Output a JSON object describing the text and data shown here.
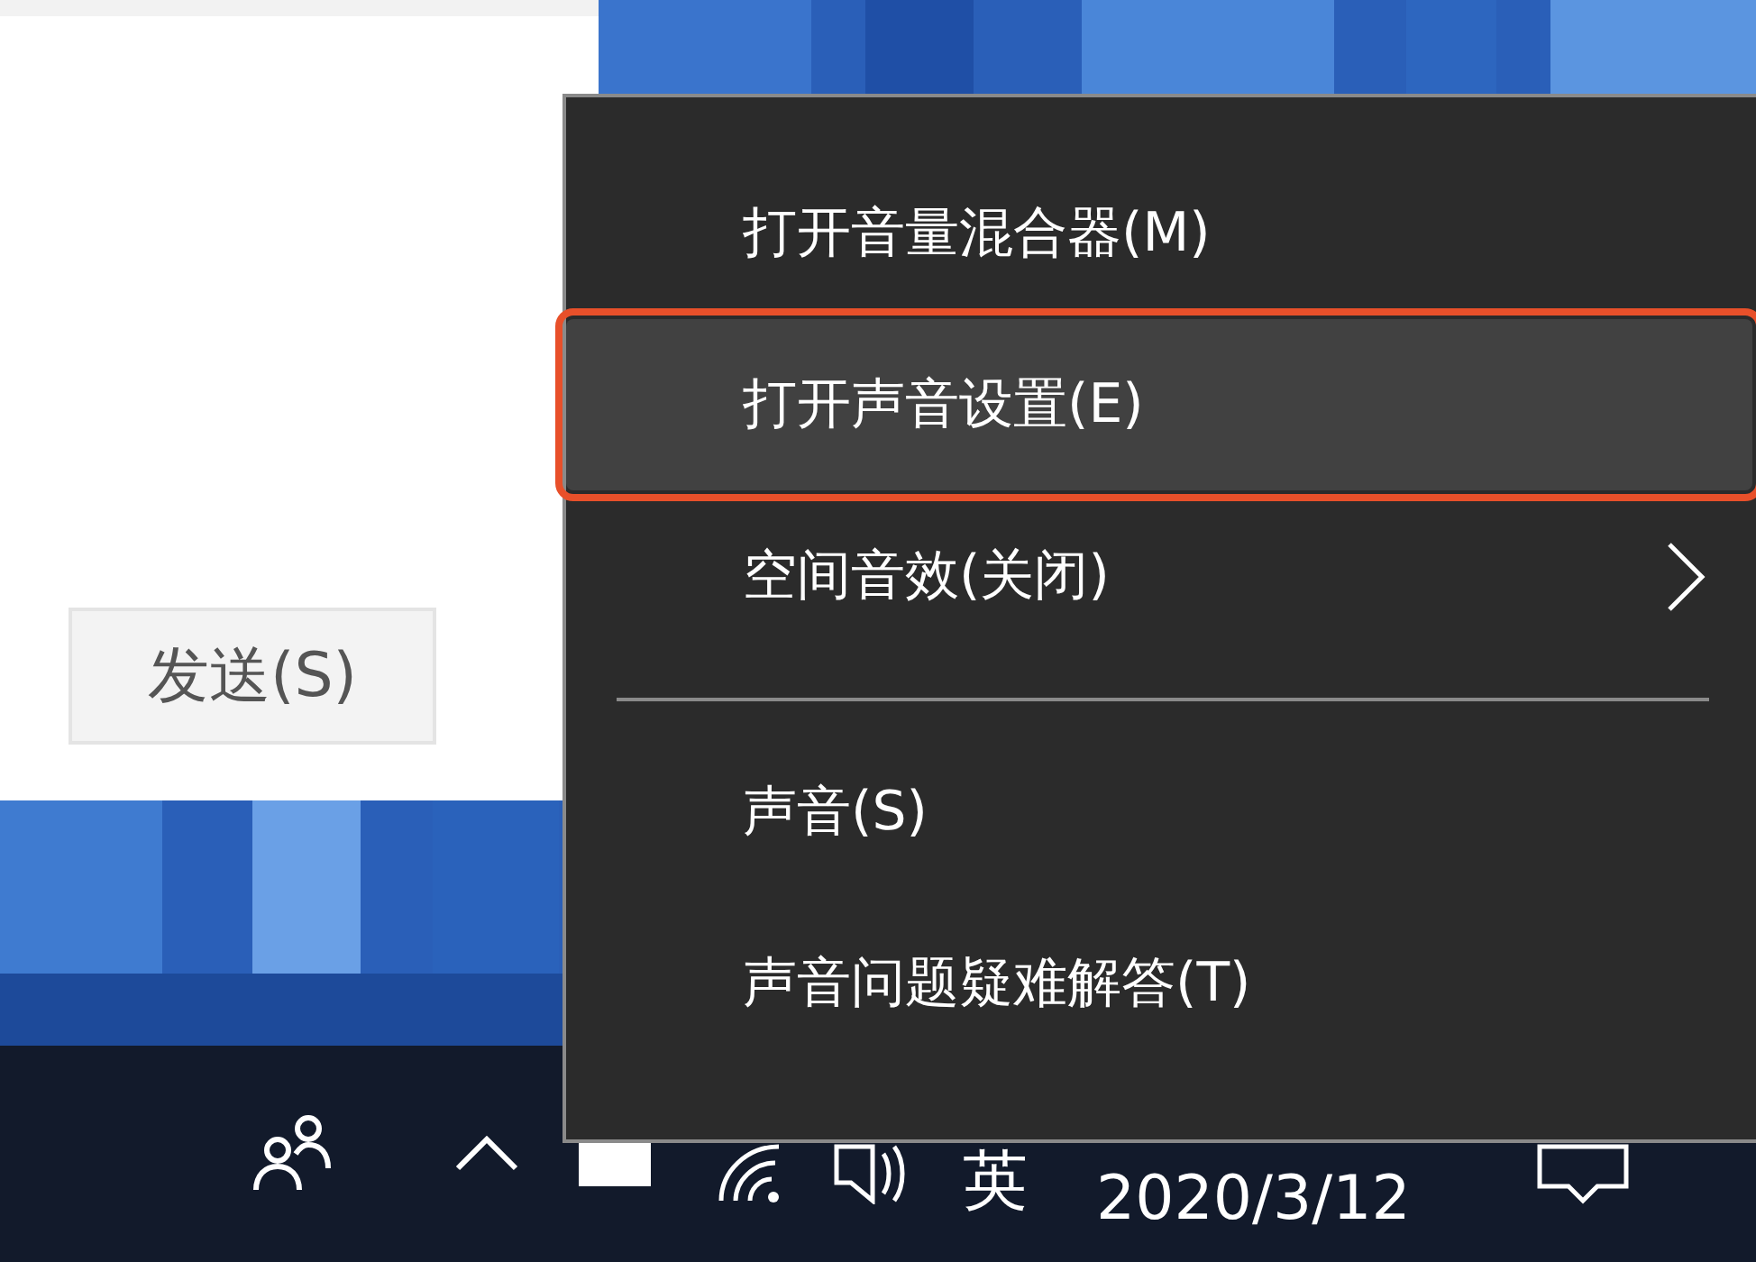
{
  "window": {
    "send_button": "发送(S)"
  },
  "context_menu": {
    "groups": [
      [
        {
          "label": "打开音量混合器(M)",
          "kind": "item",
          "selected": false,
          "outlined": false
        },
        {
          "label": "打开声音设置(E)",
          "kind": "item",
          "selected": true,
          "outlined": true
        },
        {
          "label": "空间音效(关闭)",
          "kind": "submenu",
          "selected": false,
          "outlined": false
        }
      ],
      [
        {
          "label": "声音(S)",
          "kind": "item",
          "selected": false,
          "outlined": false
        },
        {
          "label": "声音问题疑难解答(T)",
          "kind": "item",
          "selected": false,
          "outlined": false
        }
      ]
    ]
  },
  "taskbar": {
    "input_language": "英",
    "date": "2020/3/12"
  }
}
